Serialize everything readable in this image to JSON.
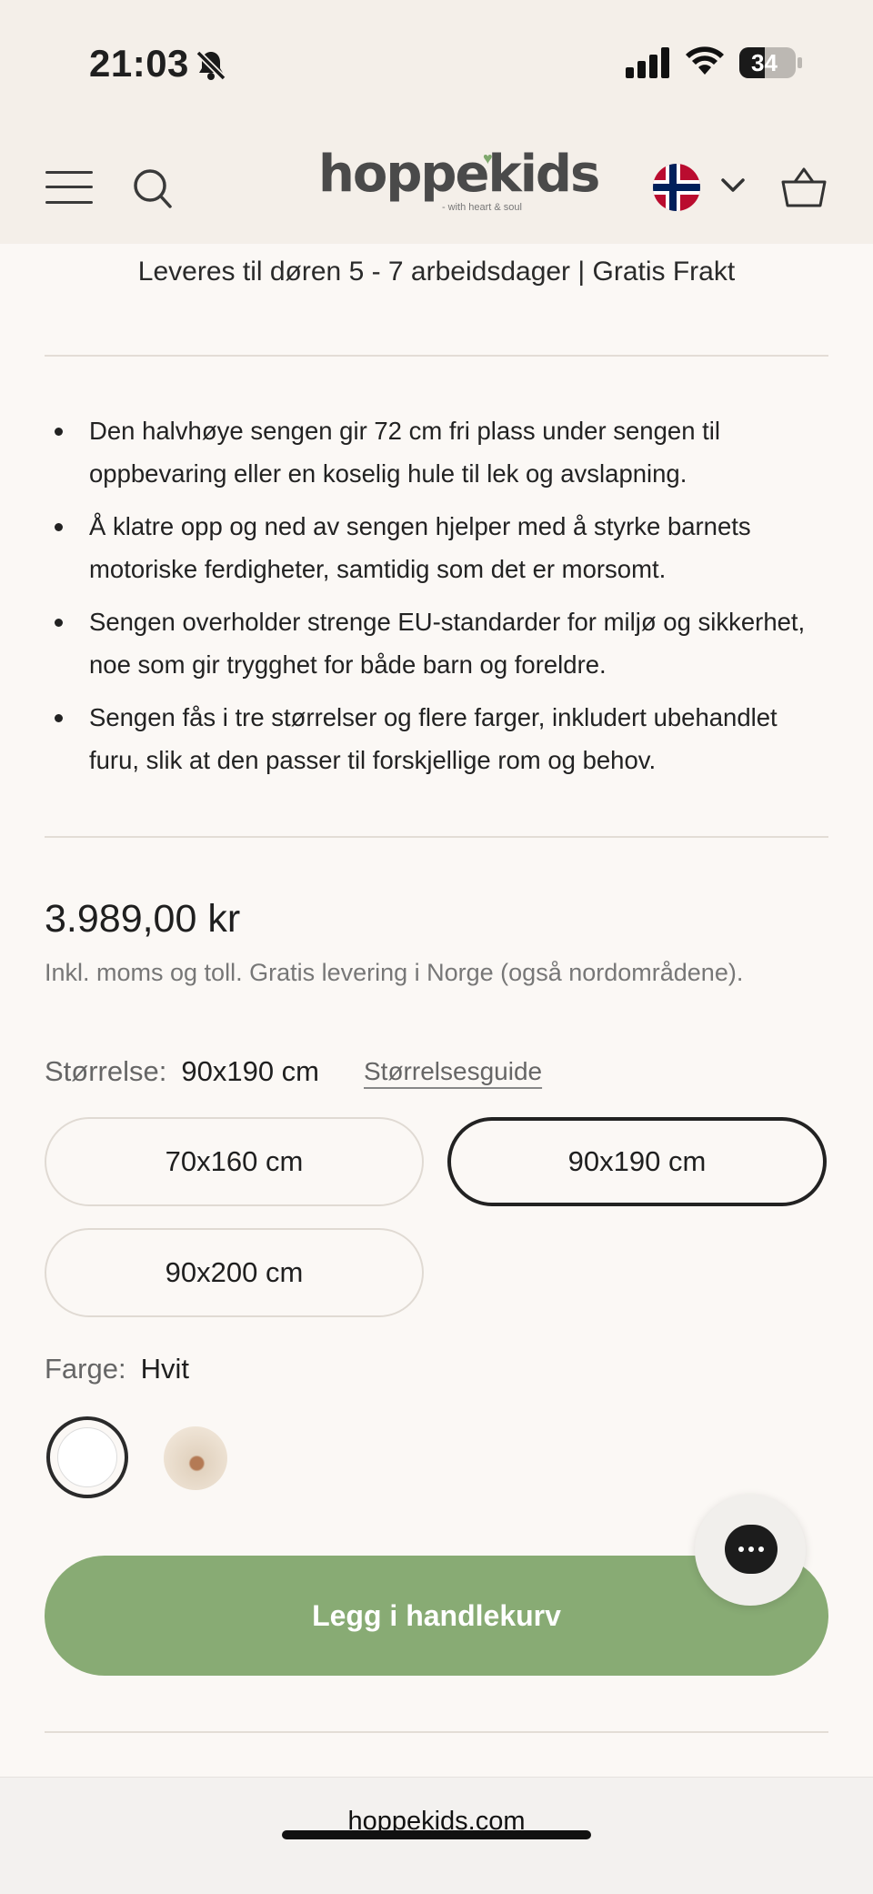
{
  "status_bar": {
    "time": "21:03",
    "battery": "34"
  },
  "header": {
    "logo_text": "hoppekids",
    "logo_tagline": "- with heart & soul",
    "icons": [
      "menu-icon",
      "search-icon",
      "norway-flag-icon",
      "chevron-down-icon",
      "basket-icon"
    ]
  },
  "delivery_text": "Leveres til døren 5 - 7 arbeidsdager | Gratis Frakt",
  "features": [
    "Den halvhøye sengen gir 72 cm fri plass under sengen til oppbevaring eller en koselig hule til lek og avslapning.",
    "Å klatre opp og ned av sengen hjelper med å styrke barnets motoriske ferdigheter, samtidig som det er morsomt.",
    "Sengen overholder strenge EU-standarder for miljø og sikkerhet, noe som gir trygghet for både barn og foreldre.",
    "Sengen fås i tre størrelser og flere farger, inkludert ubehandlet furu, slik at den passer til forskjellige rom og behov."
  ],
  "price": "3.989,00 kr",
  "tax_note": "Inkl. moms og toll. Gratis levering i Norge (også nordområdene).",
  "size": {
    "label": "Størrelse:",
    "selected": "90x190 cm",
    "guide_link": "Størrelsesguide",
    "options": [
      "70x160 cm",
      "90x190 cm",
      "90x200 cm"
    ]
  },
  "color": {
    "label": "Farge:",
    "selected": "Hvit",
    "swatches": [
      {
        "name": "Hvit",
        "hex": "#ffffff"
      },
      {
        "name": "pine",
        "hex": "#e8dccd"
      }
    ]
  },
  "add_to_cart": "Legg i handlekurv",
  "browser": {
    "domain": "hoppekids.com"
  },
  "colors": {
    "accent": "#88ab74",
    "header_bg": "#f4efe9",
    "page_bg": "#fbf8f5"
  }
}
